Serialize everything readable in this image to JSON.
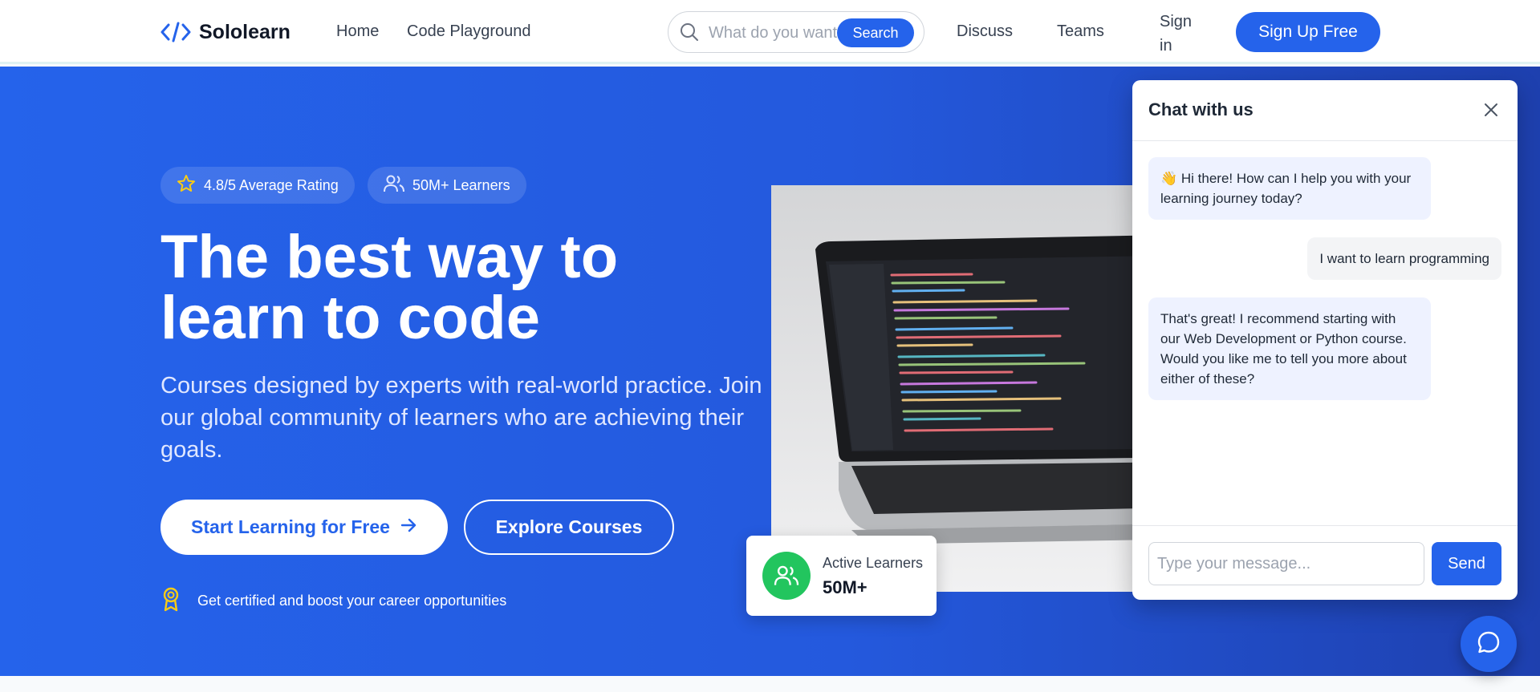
{
  "header": {
    "logo_text": "Sololearn",
    "nav": {
      "home": "Home",
      "playground": "Code Playground",
      "discuss": "Discuss",
      "teams": "Teams"
    },
    "search": {
      "placeholder": "What do you want to learn?",
      "button": "Search"
    },
    "signin": "Sign in",
    "signup": "Sign Up Free"
  },
  "hero": {
    "badges": {
      "rating": "4.8/5 Average Rating",
      "learners": "50M+ Learners"
    },
    "title": "The best way to learn to code",
    "subtitle": "Courses designed by experts with real-world practice. Join our global community of learners who are achieving their goals.",
    "cta_primary": "Start Learning for Free",
    "cta_secondary": "Explore Courses",
    "cert_text": "Get certified and boost your career opportunities"
  },
  "stats": {
    "label": "Active Learners",
    "value": "50M+"
  },
  "chat": {
    "title": "Chat with us",
    "messages": [
      {
        "from": "bot",
        "text": "👋 Hi there! How can I help you with your learning journey today?"
      },
      {
        "from": "user",
        "text": "I want to learn programming"
      },
      {
        "from": "bot",
        "text": "That's great! I recommend starting with our Web Development or Python course. Would you like me to tell you more about either of these?"
      }
    ],
    "input_placeholder": "Type your message...",
    "send": "Send"
  },
  "colors": {
    "brand": "#2563eb",
    "success": "#22c55e",
    "star": "#facc15"
  },
  "icons": [
    "code-icon",
    "search-icon",
    "star-icon",
    "users-icon",
    "arrow-right-icon",
    "award-icon",
    "close-icon",
    "chat-bubble-icon"
  ]
}
